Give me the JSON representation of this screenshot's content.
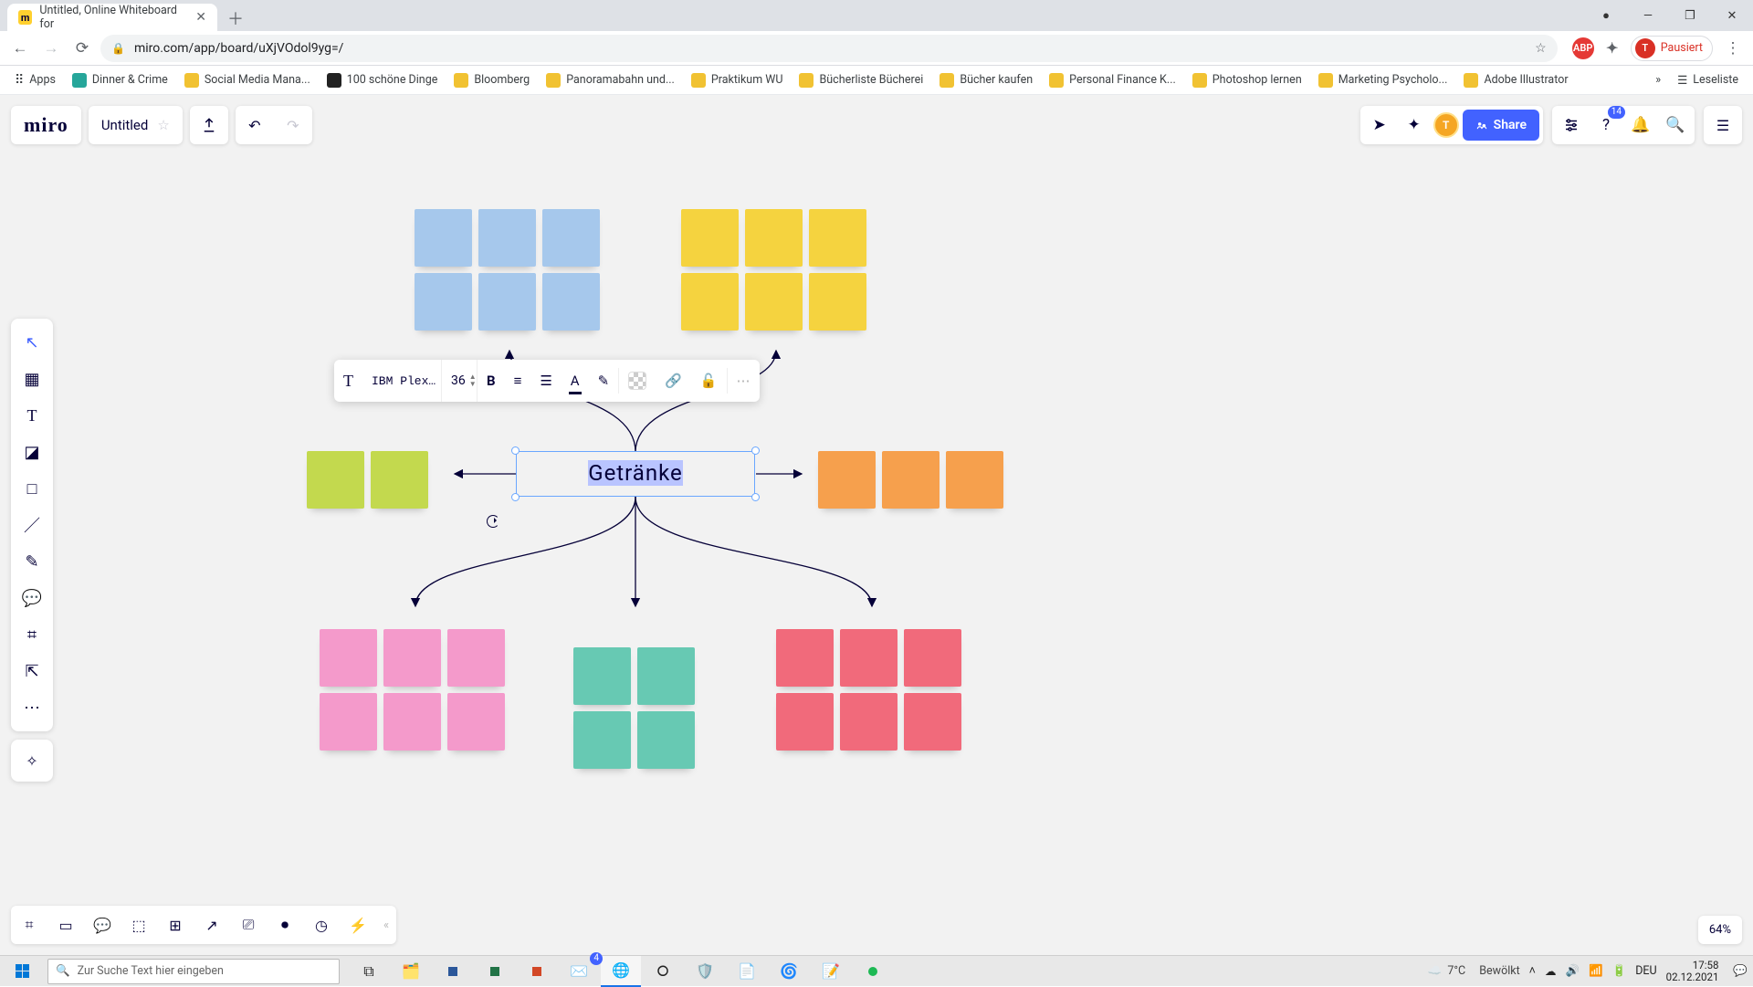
{
  "browser": {
    "tab_title": "Untitled, Online Whiteboard for",
    "url": "miro.com/app/board/uXjVOdol9yg=/",
    "pause_label": "Pausiert",
    "avatar_letter": "T",
    "reading_list": "Leseliste",
    "bookmarks": [
      "Apps",
      "Dinner & Crime",
      "Social Media Mana...",
      "100 schöne Dinge",
      "Bloomberg",
      "Panoramabahn und...",
      "Praktikum WU",
      "Bücherliste Bücherei",
      "Bücher kaufen",
      "Personal Finance K...",
      "Photoshop lernen",
      "Marketing Psycholo...",
      "Adobe Illustrator"
    ]
  },
  "miro": {
    "logo": "miro",
    "board_title": "Untitled",
    "share": "Share",
    "help_badge": "14",
    "zoom": "64%",
    "text_toolbar": {
      "font": "IBM Plex…",
      "size": "36"
    },
    "selected_text": "Getränke"
  },
  "windows": {
    "search_placeholder": "Zur Suche Text hier eingeben",
    "weather_temp": "7°C",
    "weather_desc": "Bewölkt",
    "lang": "DEU",
    "time": "17:58",
    "date": "02.12.2021",
    "mail_badge": "4"
  }
}
